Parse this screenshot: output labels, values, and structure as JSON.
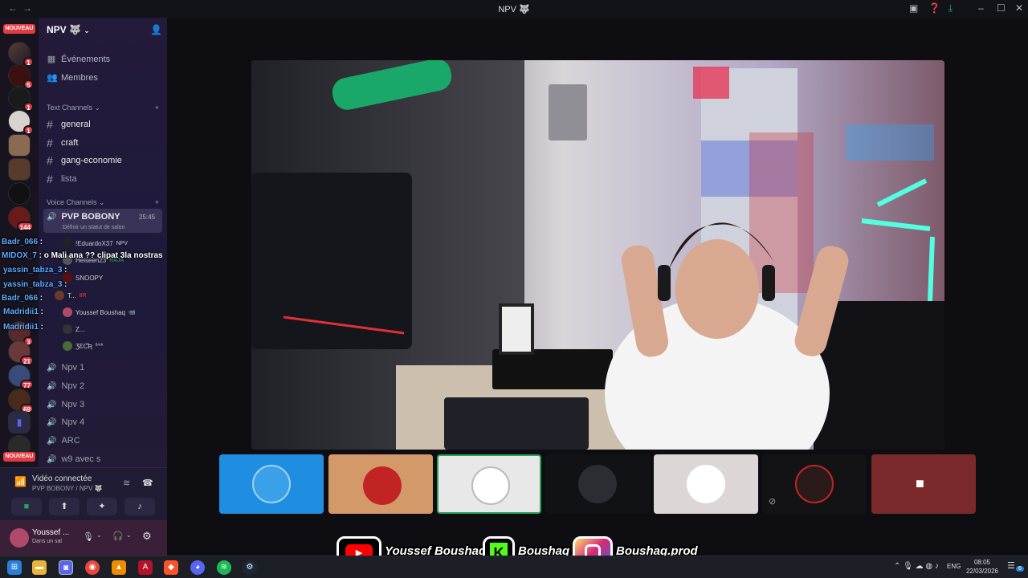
{
  "window": {
    "title": "NPV 🐺",
    "back": "←",
    "forward": "→"
  },
  "titlebar_icons": [
    "screen-icon",
    "help-icon",
    "download-icon",
    "minimize-icon",
    "maximize-icon",
    "close-icon"
  ],
  "servers": {
    "nouveau_top": "NOUVEAU",
    "nouveau_bottom": "NOUVEAU",
    "badges": [
      "1",
      "5",
      "1",
      "1",
      "144",
      "3",
      "21",
      "77",
      "69"
    ]
  },
  "channels": {
    "guild_name": "NPV 🐺",
    "top_items": [
      {
        "label": "Événements",
        "icon": "calendar-icon"
      },
      {
        "label": "Membres",
        "icon": "members-icon"
      }
    ],
    "text_category": "Text Channels",
    "text_channels": [
      "general",
      "craft",
      "gang-economie",
      "lista"
    ],
    "voice_category": "Voice Channels",
    "active_voice": {
      "name": "PVP BOBONY",
      "time": "25:45",
      "status": "Définir un statut de salon"
    },
    "members": [
      {
        "name": "!EduardoX37",
        "tag": "NPV"
      },
      {
        "name": "Heiseen23",
        "tag": "RAJA"
      },
      {
        "name": "SNOOPY",
        "tag": ""
      },
      {
        "name": "T...",
        "tag": "8R"
      },
      {
        "name": "Youssef Boushaq",
        "tag": ""
      },
      {
        "name": "Z...",
        "tag": ""
      },
      {
        "name": "ƷƐƇƦ",
        "tag": "ᴮᴬᶜᴷ"
      }
    ],
    "voice_channels": [
      "Npv 1",
      "Npv 2",
      "Npv 3",
      "Npv 4",
      "ARC",
      "w9 avec s"
    ]
  },
  "chat_overlay": [
    {
      "user": "Badr_066",
      "text": ""
    },
    {
      "user": "MIDOX_7",
      "text": "o Mali ana ?? clipat 3la nostras"
    },
    {
      "user": "yassin_tabza_3",
      "text": ""
    },
    {
      "user": "yassin_tabza_3",
      "text": ""
    },
    {
      "user": "Badr_066",
      "text": ""
    },
    {
      "user": "Madridii1",
      "text": ""
    },
    {
      "user": "Madridii1",
      "text": ""
    }
  ],
  "voice_panel": {
    "status": "Vidéo connectée",
    "location": "PVP BOBONY / NPV 🐺"
  },
  "user_panel": {
    "name": "Youssef ...",
    "status": "Dans un sal"
  },
  "banner": {
    "youtube": "Youssef Boushaq",
    "kick": "Boushaq",
    "instagram": "Boushaq.prod"
  },
  "taskbar": {
    "lang": "ENG",
    "time": "08:05",
    "date": "22/03/2026",
    "notif_count": "6"
  },
  "colors": {
    "accent": "#5865f2",
    "danger": "#e23c42",
    "connected": "#23a55a",
    "youtube": "#ff0000",
    "kick": "#53fc18"
  }
}
